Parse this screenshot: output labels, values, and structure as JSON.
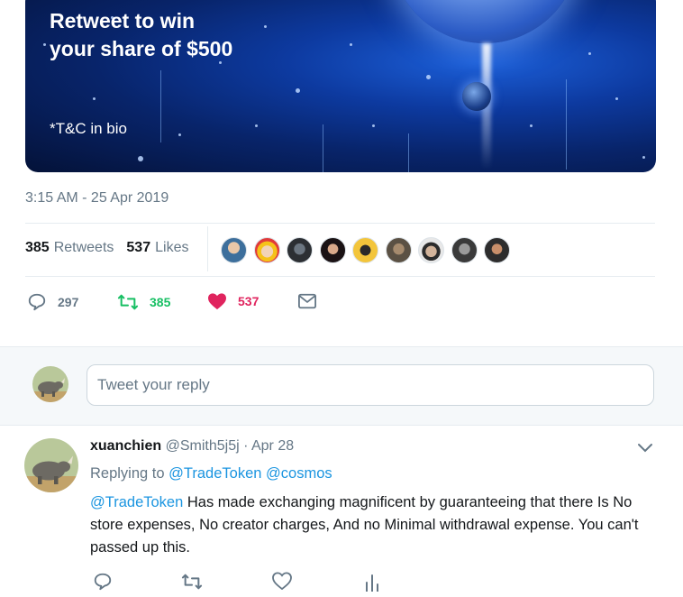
{
  "promo": {
    "headline_line1": "Retweet to win",
    "headline_line2": "your share of $500",
    "terms": "*T&C in bio"
  },
  "tweet": {
    "timestamp": "3:15 AM - 25 Apr 2019",
    "retweets_count": "385",
    "retweets_label": "Retweets",
    "likes_count": "537",
    "likes_label": "Likes",
    "reply_count": "297",
    "retweet_action_count": "385",
    "like_action_count": "537"
  },
  "reply_box": {
    "placeholder": "Tweet your reply"
  },
  "reply": {
    "display_name": "xuanchien",
    "handle": "@Smith5j5j",
    "date": "· Apr 28",
    "replying_prefix": "Replying to",
    "replying_to_1": "@TradeToken",
    "replying_to_2": "@cosmos",
    "mention": "@TradeToken",
    "text": " Has made exchanging magnificent by guaranteeing that there Is No store expenses, No creator charges, And no Minimal withdrawal expense. You can't passed up this."
  },
  "colors": {
    "accent": "#1da1f2",
    "link": "#1b95e0",
    "retweet_green": "#17bf63",
    "like_red": "#e0245e",
    "muted": "#657786"
  }
}
